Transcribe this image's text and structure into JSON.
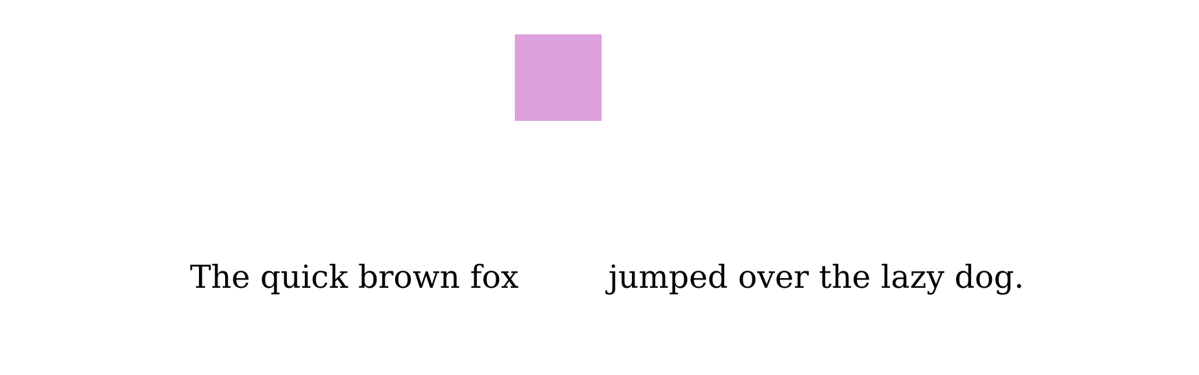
{
  "colors": {
    "background": "#ffffff",
    "square": "#dda0dd",
    "text": "#000000"
  },
  "text": {
    "left": "The quick brown fox",
    "right": "jumped over the lazy dog."
  }
}
